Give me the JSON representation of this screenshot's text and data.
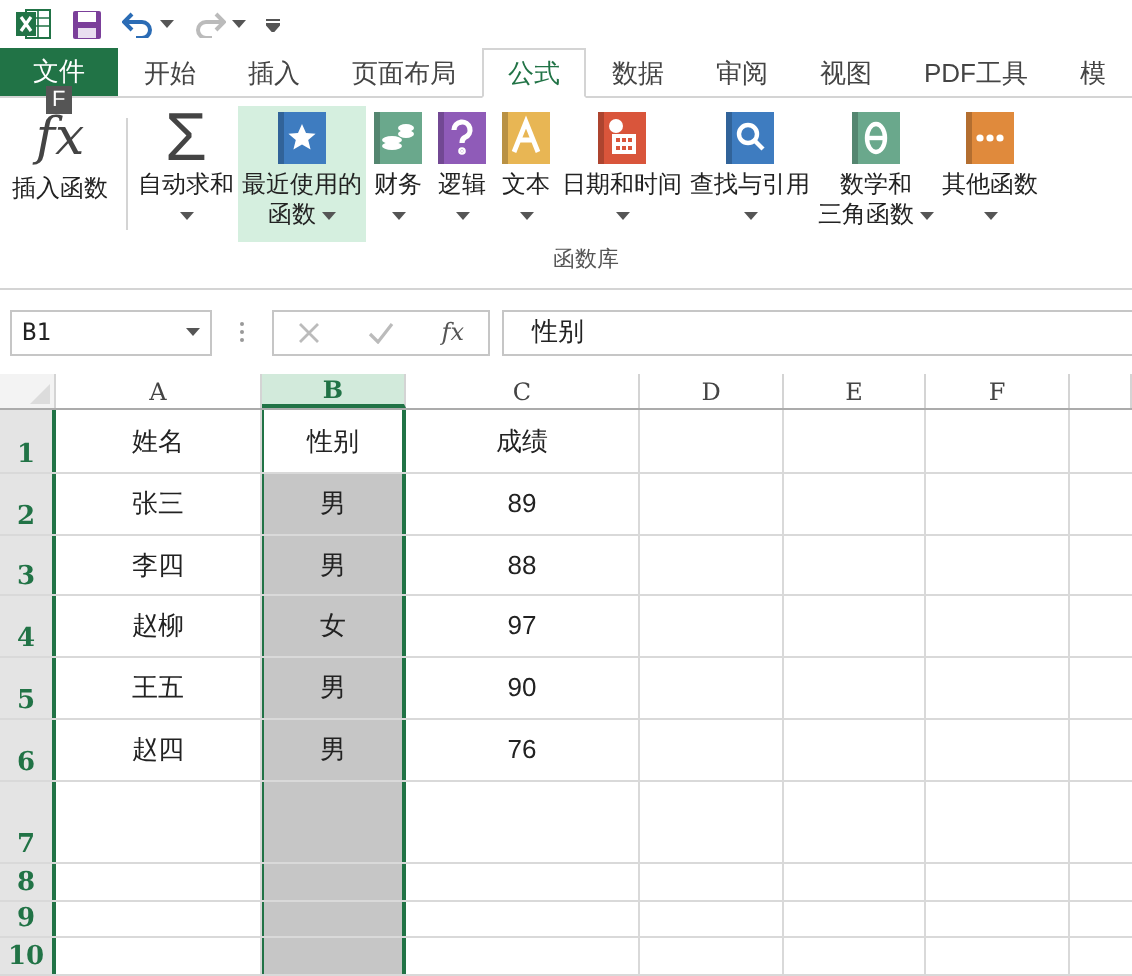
{
  "tabs": [
    {
      "label": "文件",
      "kind": "file",
      "selected": false,
      "key_tip": "F"
    },
    {
      "label": "开始",
      "kind": "tab",
      "selected": false
    },
    {
      "label": "插入",
      "kind": "tab",
      "selected": false
    },
    {
      "label": "页面布局",
      "kind": "tab",
      "selected": false
    },
    {
      "label": "公式",
      "kind": "tab",
      "selected": true
    },
    {
      "label": "数据",
      "kind": "tab",
      "selected": false
    },
    {
      "label": "审阅",
      "kind": "tab",
      "selected": false
    },
    {
      "label": "视图",
      "kind": "tab",
      "selected": false
    },
    {
      "label": "PDF工具",
      "kind": "tab",
      "selected": false
    },
    {
      "label": "模",
      "kind": "tab",
      "selected": false
    }
  ],
  "ribbon": {
    "insert_function": {
      "glyph": "fx",
      "label": "插入函数"
    },
    "buttons": [
      {
        "kind": "sum",
        "glyph": "Σ",
        "lines": [
          "自动求和"
        ],
        "dropdown": true,
        "selected": false
      },
      {
        "kind": "star",
        "lines": [
          "最近使用的",
          "函数"
        ],
        "dropdown": true,
        "selected": true
      },
      {
        "kind": "coins",
        "lines": [
          "财务"
        ],
        "dropdown": true,
        "selected": false
      },
      {
        "kind": "question",
        "lines": [
          "逻辑"
        ],
        "dropdown": true,
        "selected": false
      },
      {
        "kind": "letter",
        "lines": [
          "文本"
        ],
        "dropdown": true,
        "selected": false
      },
      {
        "kind": "calendar",
        "lines": [
          "日期和时间"
        ],
        "dropdown": true,
        "selected": false
      },
      {
        "kind": "search",
        "lines": [
          "查找与引用"
        ],
        "dropdown": true,
        "selected": false
      },
      {
        "kind": "theta",
        "lines": [
          "数学和",
          "三角函数"
        ],
        "dropdown": true,
        "selected": false
      },
      {
        "kind": "dots",
        "lines": [
          "其他函数"
        ],
        "dropdown": true,
        "selected": false
      }
    ],
    "group_label": "函数库"
  },
  "formula_bar": {
    "name_box": "B1",
    "fx": "fx",
    "value": "性别"
  },
  "columns": [
    {
      "label": "A",
      "selected": false
    },
    {
      "label": "B",
      "selected": true
    },
    {
      "label": "C",
      "selected": false
    },
    {
      "label": "D",
      "selected": false
    },
    {
      "label": "E",
      "selected": false
    },
    {
      "label": "F",
      "selected": false
    }
  ],
  "rows": [
    {
      "number": "1",
      "active": true,
      "cells": [
        "姓名",
        "性别",
        "成绩"
      ]
    },
    {
      "number": "2",
      "active": false,
      "cells": [
        "张三",
        "男",
        "89"
      ]
    },
    {
      "number": "3",
      "active": false,
      "cells": [
        "李四",
        "男",
        "88"
      ]
    },
    {
      "number": "4",
      "active": false,
      "cells": [
        "赵柳",
        "女",
        "97"
      ]
    },
    {
      "number": "5",
      "active": false,
      "cells": [
        "王五",
        "男",
        "90"
      ]
    },
    {
      "number": "6",
      "active": false,
      "cells": [
        "赵四",
        "男",
        "76"
      ]
    },
    {
      "number": "7",
      "active": false
    },
    {
      "number": "8",
      "active": false
    },
    {
      "number": "9",
      "active": false
    },
    {
      "number": "10",
      "active": false
    }
  ]
}
